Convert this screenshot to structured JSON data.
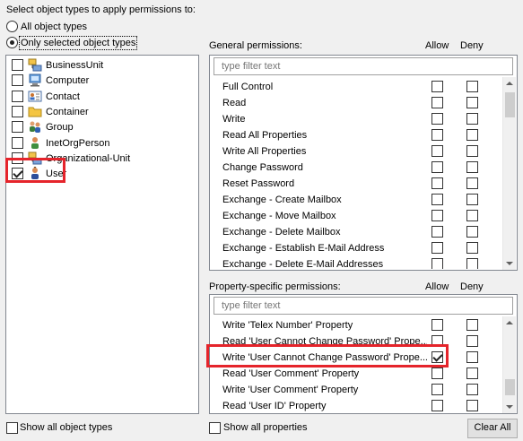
{
  "apply_to_heading": "Select object types to apply permissions to:",
  "radio_options": {
    "all": "All object types",
    "selected": "Only selected object types",
    "selected_value": "selected"
  },
  "object_types": [
    {
      "label": "BusinessUnit",
      "icon": "org-unit-icon",
      "checked": false
    },
    {
      "label": "Computer",
      "icon": "computer-icon",
      "checked": false
    },
    {
      "label": "Contact",
      "icon": "contact-card-icon",
      "checked": false
    },
    {
      "label": "Container",
      "icon": "folder-icon",
      "checked": false
    },
    {
      "label": "Group",
      "icon": "group-icon",
      "checked": false
    },
    {
      "label": "InetOrgPerson",
      "icon": "person-icon",
      "checked": false
    },
    {
      "label": "Organizational-Unit",
      "icon": "org-unit-icon",
      "checked": false
    },
    {
      "label": "User",
      "icon": "user-icon",
      "checked": true
    }
  ],
  "general": {
    "heading": "General permissions:",
    "allow_header": "Allow",
    "deny_header": "Deny",
    "filter_placeholder": "type filter text",
    "items": [
      {
        "name": "Full Control",
        "allow": false,
        "deny": false
      },
      {
        "name": "Read",
        "allow": false,
        "deny": false
      },
      {
        "name": "Write",
        "allow": false,
        "deny": false
      },
      {
        "name": "Read All Properties",
        "allow": false,
        "deny": false
      },
      {
        "name": "Write All Properties",
        "allow": false,
        "deny": false
      },
      {
        "name": "Change Password",
        "allow": false,
        "deny": false
      },
      {
        "name": "Reset Password",
        "allow": false,
        "deny": false
      },
      {
        "name": "Exchange - Create Mailbox",
        "allow": false,
        "deny": false
      },
      {
        "name": "Exchange - Move Mailbox",
        "allow": false,
        "deny": false
      },
      {
        "name": "Exchange - Delete Mailbox",
        "allow": false,
        "deny": false
      },
      {
        "name": "Exchange - Establish E-Mail Address",
        "allow": false,
        "deny": false
      },
      {
        "name": "Exchange - Delete E-Mail Addresses",
        "allow": false,
        "deny": false
      }
    ]
  },
  "property": {
    "heading": "Property-specific permissions:",
    "allow_header": "Allow",
    "deny_header": "Deny",
    "filter_placeholder": "type filter text",
    "items": [
      {
        "name": "Write 'Telex Number' Property",
        "allow": false,
        "deny": false
      },
      {
        "name": "Read 'User Cannot Change Password' Prope...",
        "allow": false,
        "deny": false
      },
      {
        "name": "Write 'User Cannot Change Password' Prope...",
        "allow": true,
        "deny": false
      },
      {
        "name": "Read 'User Comment' Property",
        "allow": false,
        "deny": false
      },
      {
        "name": "Write 'User Comment' Property",
        "allow": false,
        "deny": false
      },
      {
        "name": "Read 'User ID' Property",
        "allow": false,
        "deny": false
      }
    ]
  },
  "footer": {
    "show_all_object_types": "Show all object types",
    "show_all_properties": "Show all properties",
    "clear_all": "Clear All"
  },
  "colors": {
    "highlight": "#e5242b",
    "panel_border": "#828790"
  }
}
